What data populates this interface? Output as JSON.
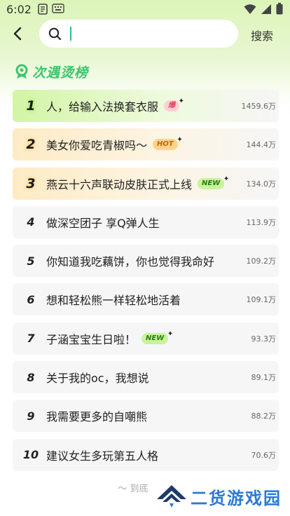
{
  "status_bar": {
    "time": "6:02"
  },
  "header": {
    "search": {
      "value": "",
      "placeholder": ""
    },
    "search_button": "搜索"
  },
  "section": {
    "title": "次遇烫榜"
  },
  "rankings": [
    {
      "rank": "1",
      "title": "人，给输入法换套衣服",
      "badge": "爆",
      "badge_type": "bao",
      "heat": "1459.6万"
    },
    {
      "rank": "2",
      "title": "美女你爱吃青椒吗～",
      "badge": "HOT",
      "badge_type": "hot",
      "heat": "144.4万"
    },
    {
      "rank": "3",
      "title": "燕云十六声联动皮肤正式上线",
      "badge": "NEW",
      "badge_type": "new",
      "heat": "134.0万"
    },
    {
      "rank": "4",
      "title": "做深空团子 享Q弹人生",
      "badge": "",
      "badge_type": "",
      "heat": "113.9万"
    },
    {
      "rank": "5",
      "title": "你知道我吃藕饼，你也觉得我命好",
      "badge": "",
      "badge_type": "",
      "heat": "109.2万"
    },
    {
      "rank": "6",
      "title": "想和轻松熊一样轻松地活着",
      "badge": "",
      "badge_type": "",
      "heat": "109.1万"
    },
    {
      "rank": "7",
      "title": "子涵宝宝生日啦！",
      "badge": "NEW",
      "badge_type": "new",
      "heat": "93.3万"
    },
    {
      "rank": "8",
      "title": "关于我的oc，我想说",
      "badge": "",
      "badge_type": "",
      "heat": "89.1万"
    },
    {
      "rank": "9",
      "title": "我需要更多的自嘲熊",
      "badge": "",
      "badge_type": "",
      "heat": "88.2万"
    },
    {
      "rank": "10",
      "title": "建议女生多玩第五人格",
      "badge": "",
      "badge_type": "",
      "heat": "70.6万"
    }
  ],
  "footer": {
    "end_text": "～ 到底"
  },
  "watermark": {
    "text": "二货游戏园"
  },
  "colors": {
    "accent": "#3cc66c",
    "caret": "#2db7a3",
    "watermark": "#2b7ad6"
  }
}
